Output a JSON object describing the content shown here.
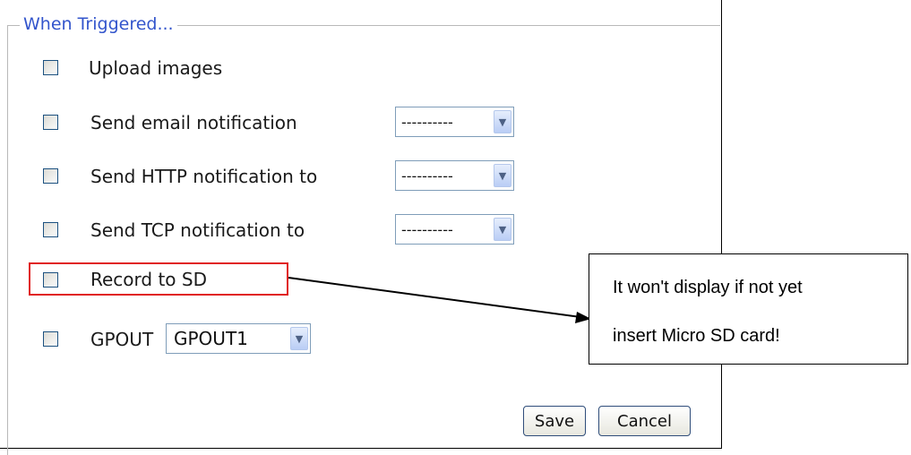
{
  "section": {
    "legend": "When Triggered..."
  },
  "options": [
    {
      "label": "Upload images",
      "checked": false
    },
    {
      "label": "Send email notification",
      "checked": false,
      "select_value": "----------"
    },
    {
      "label": "Send HTTP notification to",
      "checked": false,
      "select_value": "----------"
    },
    {
      "label": "Send TCP notification to",
      "checked": false,
      "select_value": "----------"
    },
    {
      "label": "Record to SD",
      "checked": false
    },
    {
      "label": "GPOUT",
      "checked": false,
      "select_value": "GPOUT1"
    }
  ],
  "buttons": {
    "save": "Save",
    "cancel": "Cancel"
  },
  "callout": {
    "line1": "It won't display if not yet",
    "line2": "insert Micro SD card!"
  },
  "colors": {
    "legend": "#3355cc",
    "highlight": "#e02020",
    "checkbox_border": "#1c5180"
  }
}
